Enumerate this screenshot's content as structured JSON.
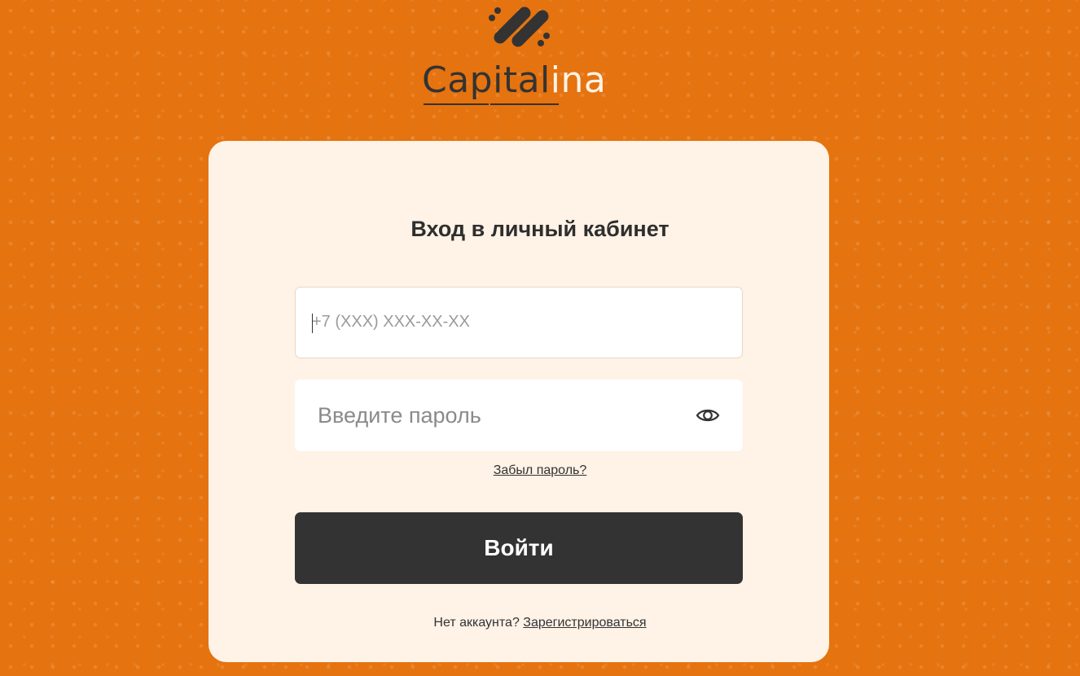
{
  "brand": {
    "name_part1": "Capital",
    "name_part2": "ina",
    "mark_icon": "capitalina-logo-mark-icon"
  },
  "colors": {
    "background": "#e5730f",
    "card": "#fff2e6",
    "dark": "#333333",
    "white": "#ffffff"
  },
  "form": {
    "title": "Вход в личный кабинет",
    "phone_placeholder": "+7 (XXX) XXX-XX-XX",
    "password_placeholder": "Введите пароль",
    "show_password_icon": "eye-icon",
    "forgot_link": "Забыл пароль?",
    "submit_label": "Войти",
    "no_account_text": "Нет аккаунта?",
    "register_link": "Зарегистрироваться"
  }
}
